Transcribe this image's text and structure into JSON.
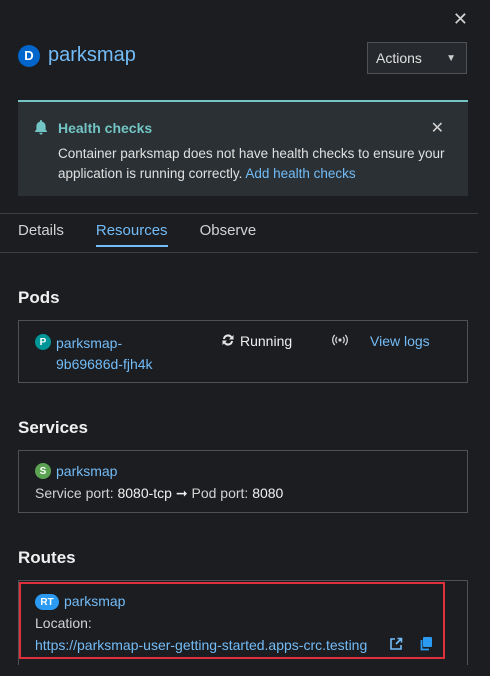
{
  "panel": {
    "close_glyph": "✕"
  },
  "header": {
    "badge": "D",
    "title": "parksmap",
    "actions_label": "Actions",
    "actions_caret": "▼"
  },
  "alert": {
    "icon": "bell-icon",
    "title": "Health checks",
    "message": "Container parksmap does not have health checks to ensure your application is running correctly.",
    "link": "Add health checks",
    "close_glyph": "✕"
  },
  "tabs": [
    "Details",
    "Resources",
    "Observe"
  ],
  "active_tab": "Resources",
  "pods": {
    "heading": "Pods",
    "items": [
      {
        "badge": "P",
        "name_line1": "parksmap-",
        "name_line2": "9b69686d-fjh4k",
        "status": "Running",
        "view_logs": "View logs"
      }
    ]
  },
  "services": {
    "heading": "Services",
    "items": [
      {
        "badge": "S",
        "name": "parksmap",
        "service_port_label": "Service port:",
        "service_port": "8080-tcp",
        "arrow": "➞",
        "pod_port_label": "Pod port:",
        "pod_port": "8080"
      }
    ]
  },
  "routes": {
    "heading": "Routes",
    "items": [
      {
        "badge": "RT",
        "name": "parksmap",
        "location_label": "Location:",
        "url": "https://parksmap-user-getting-started.apps-crc.testing"
      }
    ]
  },
  "colors": {
    "accent": "#73bcf7",
    "info": "#73c5c5",
    "highlight": "#e0303e"
  }
}
